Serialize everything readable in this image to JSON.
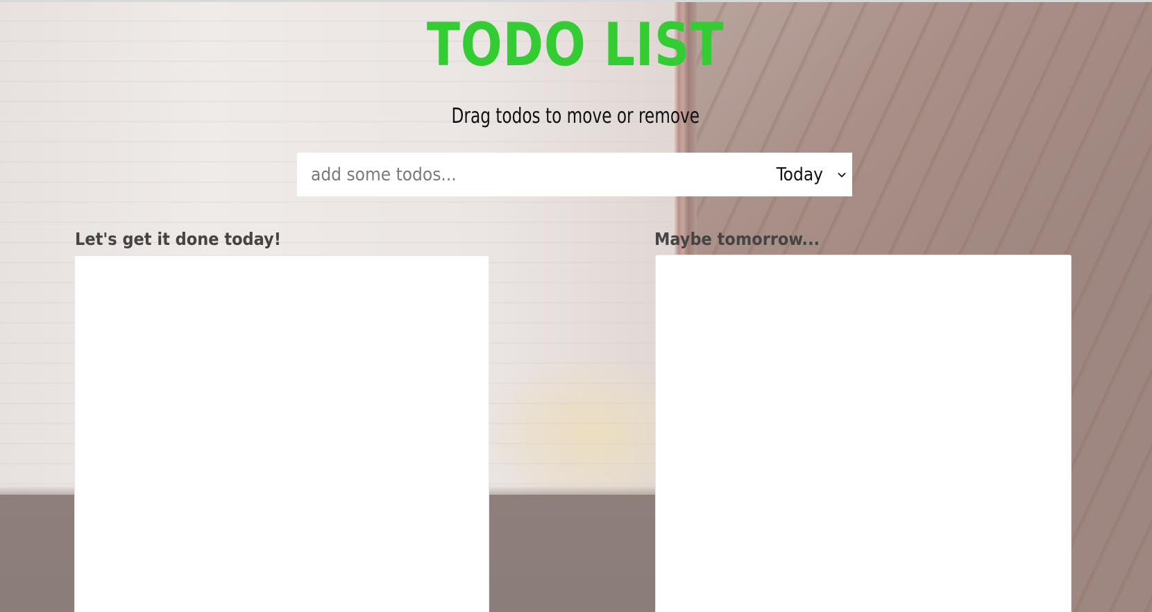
{
  "header": {
    "title": "TODO LIST",
    "subtitle": "Drag todos to move or remove"
  },
  "form": {
    "input_placeholder": "add some todos...",
    "input_value": "",
    "day_select": {
      "selected": "Today"
    }
  },
  "columns": {
    "today": {
      "heading": "Let's get it done today!",
      "items": []
    },
    "tomorrow": {
      "heading": "Maybe tomorrow...",
      "items": []
    }
  },
  "colors": {
    "title_accent": "#33cc33",
    "heading_text": "#444444",
    "panel_background": "#ffffff"
  },
  "icons": {
    "select_chevron": "chevron-down-icon"
  }
}
